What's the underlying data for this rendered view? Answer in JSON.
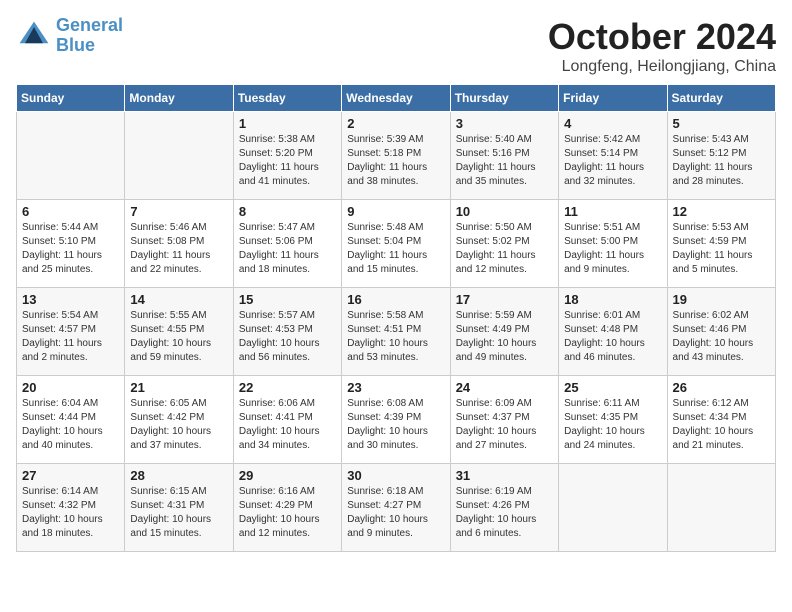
{
  "header": {
    "logo_line1": "General",
    "logo_line2": "Blue",
    "month": "October 2024",
    "location": "Longfeng, Heilongjiang, China"
  },
  "weekdays": [
    "Sunday",
    "Monday",
    "Tuesday",
    "Wednesday",
    "Thursday",
    "Friday",
    "Saturday"
  ],
  "weeks": [
    [
      {
        "day": "",
        "info": ""
      },
      {
        "day": "",
        "info": ""
      },
      {
        "day": "1",
        "info": "Sunrise: 5:38 AM\nSunset: 5:20 PM\nDaylight: 11 hours and 41 minutes."
      },
      {
        "day": "2",
        "info": "Sunrise: 5:39 AM\nSunset: 5:18 PM\nDaylight: 11 hours and 38 minutes."
      },
      {
        "day": "3",
        "info": "Sunrise: 5:40 AM\nSunset: 5:16 PM\nDaylight: 11 hours and 35 minutes."
      },
      {
        "day": "4",
        "info": "Sunrise: 5:42 AM\nSunset: 5:14 PM\nDaylight: 11 hours and 32 minutes."
      },
      {
        "day": "5",
        "info": "Sunrise: 5:43 AM\nSunset: 5:12 PM\nDaylight: 11 hours and 28 minutes."
      }
    ],
    [
      {
        "day": "6",
        "info": "Sunrise: 5:44 AM\nSunset: 5:10 PM\nDaylight: 11 hours and 25 minutes."
      },
      {
        "day": "7",
        "info": "Sunrise: 5:46 AM\nSunset: 5:08 PM\nDaylight: 11 hours and 22 minutes."
      },
      {
        "day": "8",
        "info": "Sunrise: 5:47 AM\nSunset: 5:06 PM\nDaylight: 11 hours and 18 minutes."
      },
      {
        "day": "9",
        "info": "Sunrise: 5:48 AM\nSunset: 5:04 PM\nDaylight: 11 hours and 15 minutes."
      },
      {
        "day": "10",
        "info": "Sunrise: 5:50 AM\nSunset: 5:02 PM\nDaylight: 11 hours and 12 minutes."
      },
      {
        "day": "11",
        "info": "Sunrise: 5:51 AM\nSunset: 5:00 PM\nDaylight: 11 hours and 9 minutes."
      },
      {
        "day": "12",
        "info": "Sunrise: 5:53 AM\nSunset: 4:59 PM\nDaylight: 11 hours and 5 minutes."
      }
    ],
    [
      {
        "day": "13",
        "info": "Sunrise: 5:54 AM\nSunset: 4:57 PM\nDaylight: 11 hours and 2 minutes."
      },
      {
        "day": "14",
        "info": "Sunrise: 5:55 AM\nSunset: 4:55 PM\nDaylight: 10 hours and 59 minutes."
      },
      {
        "day": "15",
        "info": "Sunrise: 5:57 AM\nSunset: 4:53 PM\nDaylight: 10 hours and 56 minutes."
      },
      {
        "day": "16",
        "info": "Sunrise: 5:58 AM\nSunset: 4:51 PM\nDaylight: 10 hours and 53 minutes."
      },
      {
        "day": "17",
        "info": "Sunrise: 5:59 AM\nSunset: 4:49 PM\nDaylight: 10 hours and 49 minutes."
      },
      {
        "day": "18",
        "info": "Sunrise: 6:01 AM\nSunset: 4:48 PM\nDaylight: 10 hours and 46 minutes."
      },
      {
        "day": "19",
        "info": "Sunrise: 6:02 AM\nSunset: 4:46 PM\nDaylight: 10 hours and 43 minutes."
      }
    ],
    [
      {
        "day": "20",
        "info": "Sunrise: 6:04 AM\nSunset: 4:44 PM\nDaylight: 10 hours and 40 minutes."
      },
      {
        "day": "21",
        "info": "Sunrise: 6:05 AM\nSunset: 4:42 PM\nDaylight: 10 hours and 37 minutes."
      },
      {
        "day": "22",
        "info": "Sunrise: 6:06 AM\nSunset: 4:41 PM\nDaylight: 10 hours and 34 minutes."
      },
      {
        "day": "23",
        "info": "Sunrise: 6:08 AM\nSunset: 4:39 PM\nDaylight: 10 hours and 30 minutes."
      },
      {
        "day": "24",
        "info": "Sunrise: 6:09 AM\nSunset: 4:37 PM\nDaylight: 10 hours and 27 minutes."
      },
      {
        "day": "25",
        "info": "Sunrise: 6:11 AM\nSunset: 4:35 PM\nDaylight: 10 hours and 24 minutes."
      },
      {
        "day": "26",
        "info": "Sunrise: 6:12 AM\nSunset: 4:34 PM\nDaylight: 10 hours and 21 minutes."
      }
    ],
    [
      {
        "day": "27",
        "info": "Sunrise: 6:14 AM\nSunset: 4:32 PM\nDaylight: 10 hours and 18 minutes."
      },
      {
        "day": "28",
        "info": "Sunrise: 6:15 AM\nSunset: 4:31 PM\nDaylight: 10 hours and 15 minutes."
      },
      {
        "day": "29",
        "info": "Sunrise: 6:16 AM\nSunset: 4:29 PM\nDaylight: 10 hours and 12 minutes."
      },
      {
        "day": "30",
        "info": "Sunrise: 6:18 AM\nSunset: 4:27 PM\nDaylight: 10 hours and 9 minutes."
      },
      {
        "day": "31",
        "info": "Sunrise: 6:19 AM\nSunset: 4:26 PM\nDaylight: 10 hours and 6 minutes."
      },
      {
        "day": "",
        "info": ""
      },
      {
        "day": "",
        "info": ""
      }
    ]
  ]
}
